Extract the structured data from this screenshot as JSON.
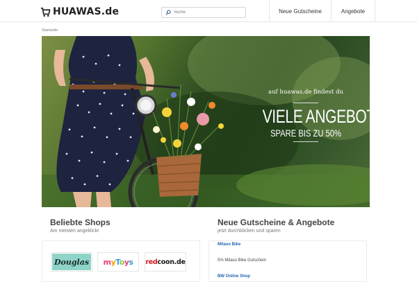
{
  "header": {
    "logo_text": "HUAWAS.de",
    "logo_icon": "shopping-cart-icon",
    "search_placeholder": "Suche",
    "nav": [
      {
        "label": "Neue Gutscheine"
      },
      {
        "label": "Angebote"
      }
    ]
  },
  "breadcrumb": "Startseite",
  "hero": {
    "small_text": "auf huawas.de findest du",
    "headline": "VIELE ANGEBOTE",
    "subline": "SPARE BIS ZU 50%"
  },
  "shops": {
    "title": "Beliebte Shops",
    "subtitle": "Am meisten angeklickt",
    "logos": [
      {
        "name": "Douglas"
      },
      {
        "name": "myToys"
      },
      {
        "name": "redcoon.de",
        "part1": "red",
        "part2": "coon.de"
      }
    ]
  },
  "deals": {
    "title": "Neue Gutscheine & Angebote",
    "subtitle": "jetzt durchklicken und sparen",
    "items": [
      {
        "shop": "Mitaso Bike",
        "text": "5% Mitaso Bike Gutschein"
      },
      {
        "shop": "BW Online Shop",
        "text": ""
      }
    ]
  },
  "colors": {
    "link": "#1e64b4",
    "douglas_bg": "#8fd4c8",
    "redcoon": "#d2161b"
  }
}
